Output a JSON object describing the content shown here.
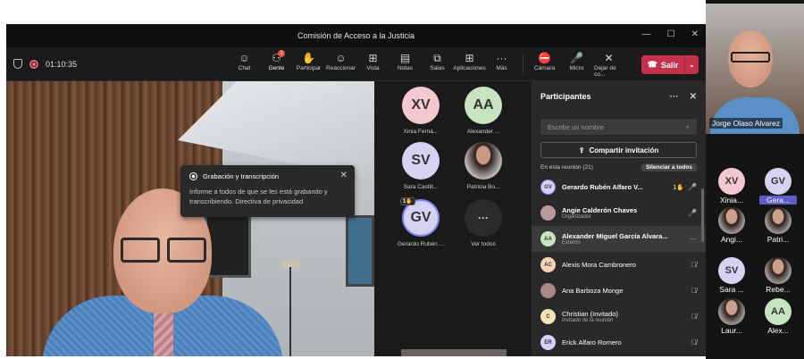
{
  "window": {
    "title": "Comisión de Acceso a la Justicia",
    "minimize": "—",
    "maximize": "☐",
    "close": "✕"
  },
  "meeting": {
    "timer": "01:10:35"
  },
  "toolbar": {
    "items": [
      {
        "label": "Chat",
        "icon": "chat-icon",
        "glyph": "☺"
      },
      {
        "label": "Gente",
        "icon": "people-icon",
        "glyph": "⚇",
        "badge": "1"
      },
      {
        "label": "Participar",
        "icon": "raise-hand-icon",
        "glyph": "✋"
      },
      {
        "label": "Reaccionar",
        "icon": "react-icon",
        "glyph": "☺"
      },
      {
        "label": "Vista",
        "icon": "view-icon",
        "glyph": "⊞"
      },
      {
        "label": "Notas",
        "icon": "notes-icon",
        "glyph": "▤"
      },
      {
        "label": "Salas",
        "icon": "rooms-icon",
        "glyph": "⧉"
      },
      {
        "label": "Aplicaciones",
        "icon": "apps-icon",
        "glyph": "⊞"
      },
      {
        "label": "Más",
        "icon": "more-icon",
        "glyph": "···"
      },
      {
        "label": "Cámara",
        "icon": "camera-off-icon",
        "glyph": "⛔"
      },
      {
        "label": "Micro",
        "icon": "mic-icon",
        "glyph": "🎤"
      },
      {
        "label": "Dejar de co...",
        "icon": "stop-share-icon",
        "glyph": "✕"
      }
    ],
    "leave_label": "Salir"
  },
  "recording_popup": {
    "title": "Grabación y transcripción",
    "body": "Informe a todos de que se les está grabando y transcribiendo. Directiva de privacidad"
  },
  "gallery": {
    "tiles": [
      {
        "initials": "XV",
        "name": "Xinia Ferná...",
        "color": "#f3c9cf"
      },
      {
        "initials": "AA",
        "name": "Alexander ...",
        "color": "#c6e4c0"
      },
      {
        "initials": "SV",
        "name": "Sara Castill...",
        "color": "#d6d2f2"
      },
      {
        "initials": "",
        "name": "Patricia Bo...",
        "color": "#999"
      },
      {
        "initials": "GV",
        "name": "Gerardo Rubén ...",
        "color": "#d6d2f2",
        "hand": "1✋"
      },
      {
        "initials": "···",
        "name": "Ver todos",
        "color": "#2b2b2b"
      }
    ]
  },
  "panel": {
    "title": "Participantes",
    "search_placeholder": "Escribe un nombre",
    "share_label": "Compartir invitación",
    "section_label": "En esta reunión (21)",
    "mute_all_label": "Silenciar a todos",
    "participants": [
      {
        "initials": "GV",
        "name": "Gerardo Rubén Alfaro V...",
        "sub": "",
        "color": "#d6d2f2",
        "hand": "1✋",
        "icon": "🎤"
      },
      {
        "initials": "",
        "name": "Angie Calderón Chaves",
        "sub": "Organizador",
        "color": "#b99",
        "icon": "🎤"
      },
      {
        "initials": "AA",
        "name": "Alexander Miguel García Alvara...",
        "sub": "Externo",
        "color": "#c6e4c0",
        "icon": "···"
      },
      {
        "initials": "AC",
        "name": "Alexis Mora Cambronero",
        "sub": "",
        "color": "#f6d2b4",
        "icon": "🎙̸"
      },
      {
        "initials": "",
        "name": "Ana Barboza Monge",
        "sub": "",
        "color": "#a88",
        "icon": "🎙̸"
      },
      {
        "initials": "C",
        "name": "Christian (Invitado)",
        "sub": "Invitado de la reunión",
        "color": "#f3e3b4",
        "icon": "🎙̸"
      },
      {
        "initials": "ER",
        "name": "Erick Alfaro Romero",
        "sub": "",
        "color": "#cfd3f7",
        "icon": "🎙̸"
      }
    ]
  },
  "speaker": {
    "name": "Jorge Olaso Alvarez"
  },
  "side_list": [
    {
      "initials": "XV",
      "name": "Xinia...",
      "color": "#f3c9cf"
    },
    {
      "initials": "GV",
      "name": "Gera...",
      "color": "#d6d2f2",
      "selected": true
    },
    {
      "initials": "",
      "name": "Angi...",
      "color": "#999"
    },
    {
      "initials": "",
      "name": "Patri...",
      "color": "#999"
    },
    {
      "initials": "SV",
      "name": "Sara ...",
      "color": "#d6d2f2"
    },
    {
      "initials": "",
      "name": "Rebe...",
      "color": "#999"
    },
    {
      "initials": "",
      "name": "Laur...",
      "color": "#999"
    },
    {
      "initials": "AA",
      "name": "Alex...",
      "color": "#c6e4c0"
    }
  ]
}
